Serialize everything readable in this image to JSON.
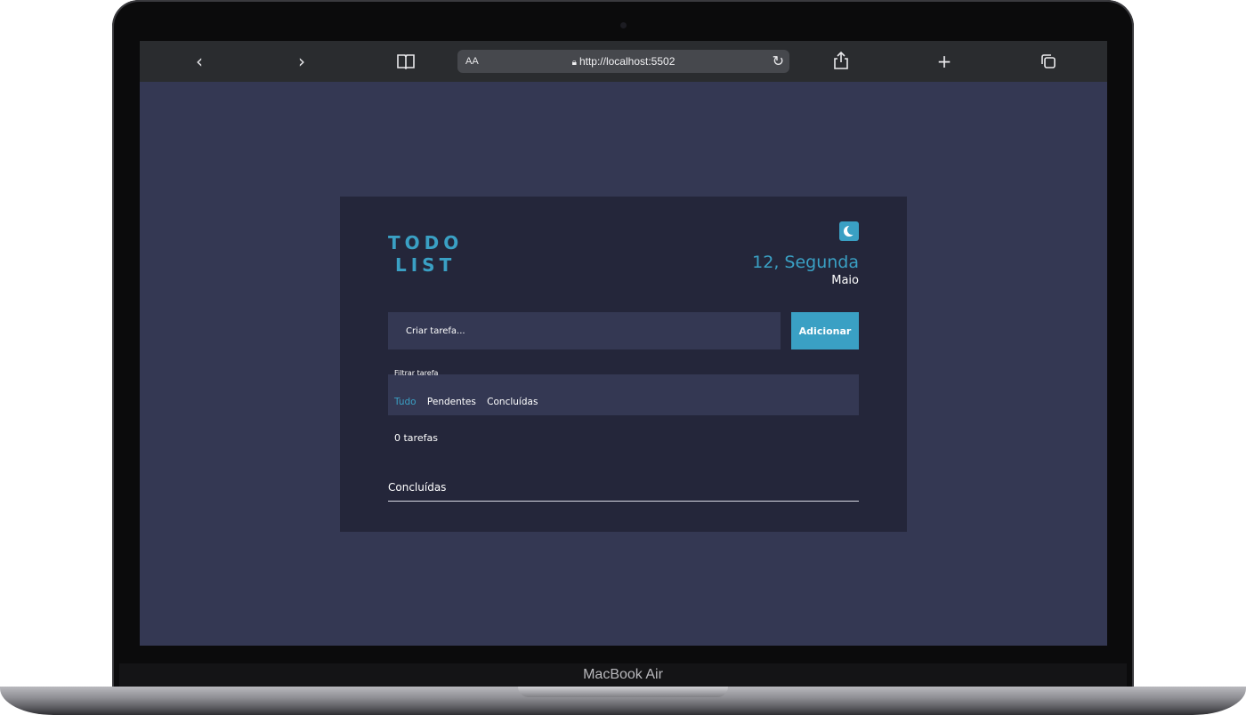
{
  "device": {
    "label": "MacBook Air"
  },
  "browser": {
    "text_size_label": "AA",
    "url": "http://localhost:5502",
    "icons": {
      "back": "chevron-left-icon",
      "forward": "chevron-right-icon",
      "bookmarks": "book-icon",
      "lock": "lock-icon",
      "reload": "reload-icon",
      "share": "share-icon",
      "new_tab": "plus-icon",
      "tabs": "tabs-icon"
    }
  },
  "app": {
    "title_line1": "TODO",
    "title_line2": "LIST",
    "theme_icon": "moon-icon",
    "date_day": "12, Segunda",
    "date_month": "Maio",
    "input_placeholder": "Criar tarefa...",
    "add_label": "Adicionar",
    "filter": {
      "label": "Filtrar tarefa",
      "options": [
        "Tudo",
        "Pendentes",
        "Concluídas"
      ],
      "active": "Tudo"
    },
    "task_count": "0 tarefas",
    "completed_title": "Concluídas",
    "colors": {
      "accent": "#3aa0c4",
      "background": "#343853",
      "card": "#24263a",
      "text": "#ffffff"
    }
  }
}
